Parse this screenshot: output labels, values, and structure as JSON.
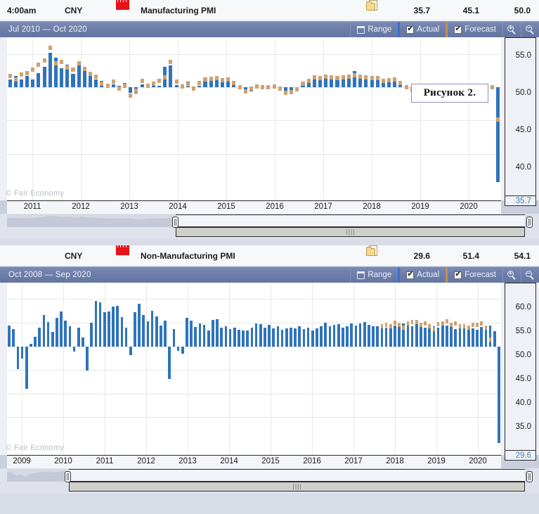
{
  "events": [
    {
      "time": "4:00am",
      "currency": "CNY",
      "flag_icon": "china-flag-icon",
      "detail_icon": "detail-folder-icon",
      "title": "Manufacturing PMI",
      "actual": "35.7",
      "forecast": "45.1",
      "previous": "50.0",
      "chart": {
        "range_label": "Jul 2010 — Oct 2020",
        "toolbar": {
          "range_label": "Range",
          "range_icon": "calendar-icon",
          "actual_label": "Actual",
          "actual_checked": true,
          "forecast_label": "Forecast",
          "forecast_checked": true,
          "zoom_in_icon": "magnifier-plus-icon",
          "zoom_out_icon": "magnifier-minus-icon"
        },
        "watermark": "© Fair Economy",
        "annotation": "Рисунок 2.",
        "current_value_label": "35.7"
      }
    },
    {
      "time": "",
      "currency": "CNY",
      "flag_icon": "china-flag-icon",
      "detail_icon": "detail-folder-icon",
      "title": "Non-Manufacturing PMI",
      "actual": "29.6",
      "forecast": "51.4",
      "previous": "54.1",
      "chart": {
        "range_label": "Oct 2008 — Sep 2020",
        "toolbar": {
          "range_label": "Range",
          "range_icon": "calendar-icon",
          "actual_label": "Actual",
          "actual_checked": true,
          "forecast_label": "Forecast",
          "forecast_checked": true,
          "zoom_in_icon": "magnifier-plus-icon",
          "zoom_out_icon": "magnifier-minus-icon"
        },
        "watermark": "© Fair Economy",
        "annotation": "",
        "current_value_label": "29.6"
      }
    }
  ],
  "chart_data": [
    {
      "type": "bar",
      "title": "Manufacturing PMI",
      "subtitle": "Jul 2010 — Oct 2020",
      "xlabel": "",
      "ylabel": "",
      "ylim": [
        33.0,
        57.5
      ],
      "baseline": 50.0,
      "grid": true,
      "legend": [
        "Actual",
        "Forecast"
      ],
      "legend_position": "toolbar",
      "yticks": [
        55.0,
        50.0,
        45.0,
        40.0
      ],
      "ytick_labels": [
        "55.0",
        "50.0",
        "45.0",
        "40.0"
      ],
      "current_value": 35.7,
      "xticks": [
        "2011",
        "2012",
        "2013",
        "2014",
        "2015",
        "2016",
        "2017",
        "2018",
        "2019",
        "2020"
      ],
      "series": [
        {
          "name": "Actual",
          "color": "#2f74bb",
          "values": [
            51.2,
            51.7,
            51.2,
            51.7,
            51.2,
            52.1,
            53.1,
            55.2,
            54.4,
            52.9,
            53.4,
            52.0,
            53.3,
            52.4,
            51.8,
            51.2,
            50.9,
            50.1,
            50.4,
            50.2,
            50.6,
            49.2,
            49.0,
            50.4,
            50.1,
            50.6,
            50.2,
            53.1,
            53.3,
            50.3,
            50.4,
            50.8,
            50.1,
            50.2,
            51.0,
            51.1,
            51.7,
            51.4,
            51.1,
            50.8,
            50.1,
            49.7,
            49.4,
            49.8,
            50.1,
            49.9,
            50.2,
            50.1,
            49.4,
            49.0,
            49.4,
            50.2,
            51.2,
            51.7,
            51.6,
            51.8,
            51.3,
            51.2,
            51.6,
            51.4,
            52.4,
            51.7,
            51.2,
            51.5,
            51.6,
            51.2,
            50.8,
            51.5,
            50.9,
            50.3,
            49.4,
            49.2,
            49.5,
            49.2,
            49.4,
            49.7,
            50.2,
            49.4,
            49.7,
            49.5,
            49.8,
            49.9,
            49.8,
            50.2,
            50.1,
            35.7
          ],
          "note": "Monthly China Manufacturing PMI, approximate read from plot"
        },
        {
          "name": "Forecast",
          "color": "#cda273",
          "values": [
            51.7,
            51.2,
            51.9,
            52.1,
            52.6,
            53.4,
            54.0,
            55.9,
            53.6,
            53.8,
            53.0,
            52.6,
            53.6,
            52.8,
            52.0,
            51.6,
            50.5,
            50.2,
            50.8,
            49.8,
            50.2,
            48.7,
            49.5,
            50.9,
            50.2,
            50.5,
            50.9,
            51.5,
            53.8,
            50.8,
            50.1,
            50.4,
            49.8,
            50.6,
            51.2,
            51.3,
            51.4,
            51.1,
            51.2,
            50.6,
            50.0,
            49.4,
            49.8,
            50.1,
            50.0,
            50.0,
            50.1,
            49.8,
            49.2,
            49.3,
            49.7,
            50.5,
            51.0,
            51.5,
            51.4,
            51.6,
            51.5,
            51.4,
            51.5,
            51.6,
            51.8,
            51.6,
            51.5,
            51.4,
            51.4,
            51.0,
            51.1,
            51.2,
            50.6,
            50.0,
            49.6,
            49.5,
            49.3,
            49.6,
            49.6,
            50.0,
            49.9,
            49.6,
            49.5,
            49.8,
            50.0,
            50.1,
            50.0,
            50.1,
            50.0,
            45.1
          ]
        }
      ]
    },
    {
      "type": "bar",
      "title": "Non-Manufacturing PMI",
      "subtitle": "Oct 2008 — Sep 2020",
      "xlabel": "",
      "ylabel": "",
      "ylim": [
        27.0,
        63.5
      ],
      "baseline": 50.0,
      "grid": true,
      "legend": [
        "Actual",
        "Forecast"
      ],
      "legend_position": "toolbar",
      "yticks": [
        60.0,
        55.0,
        50.0,
        45.0,
        40.0,
        35.0
      ],
      "ytick_labels": [
        "60.0",
        "55.0",
        "50.0",
        "45.0",
        "40.0",
        "35.0"
      ],
      "current_value": 29.6,
      "xticks": [
        "2009",
        "2010",
        "2011",
        "2012",
        "2013",
        "2014",
        "2015",
        "2016",
        "2017",
        "2018",
        "2019",
        "2020"
      ],
      "series": [
        {
          "name": "Actual",
          "color": "#2f74bb",
          "values": [
            54.4,
            53.6,
            45.2,
            47.4,
            41.0,
            50.5,
            52.0,
            54.0,
            56.6,
            55.1,
            53.0,
            56.0,
            57.4,
            55.5,
            54.2,
            48.9,
            53.9,
            51.9,
            44.9,
            55.0,
            59.6,
            59.4,
            57.2,
            57.4,
            58.4,
            58.6,
            56.2,
            53.9,
            48.1,
            57.3,
            59.0,
            56.7,
            55.3,
            57.6,
            56.4,
            54.4,
            55.5,
            43.1,
            53.7,
            49.1,
            48.5,
            56.0,
            55.4,
            54.1,
            54.9,
            54.5,
            53.3,
            55.6,
            55.8,
            54.0,
            54.2,
            53.6,
            53.9,
            53.5,
            53.4,
            53.3,
            53.9,
            54.8,
            54.7,
            53.9,
            54.6,
            53.8,
            54.2,
            53.5,
            53.8,
            54.0,
            53.8,
            54.3,
            53.7,
            54.0,
            53.4,
            53.8,
            54.3,
            55.0,
            54.3,
            54.5,
            54.7,
            54.0,
            54.3,
            54.9,
            54.4,
            54.8,
            55.1,
            54.6,
            54.2,
            54.2,
            54.3,
            54.0,
            53.9,
            54.4,
            54.8,
            54.8,
            55.0,
            54.3,
            54.8,
            54.4,
            53.9,
            54.5,
            54.2,
            53.9,
            54.7,
            54.4,
            54.2,
            53.7,
            54.2,
            54.4,
            53.6,
            53.8,
            53.5,
            54.1,
            54.2,
            54.4,
            53.2,
            29.6
          ]
        },
        {
          "name": "Forecast",
          "color": "#cda273",
          "values": [
            null,
            null,
            null,
            null,
            null,
            null,
            null,
            null,
            null,
            null,
            null,
            null,
            null,
            null,
            null,
            null,
            null,
            null,
            null,
            null,
            null,
            null,
            null,
            null,
            null,
            null,
            null,
            null,
            null,
            null,
            null,
            null,
            null,
            null,
            null,
            null,
            null,
            null,
            null,
            null,
            null,
            null,
            null,
            null,
            null,
            null,
            null,
            null,
            null,
            null,
            null,
            null,
            null,
            null,
            null,
            null,
            null,
            null,
            null,
            null,
            null,
            null,
            null,
            null,
            null,
            null,
            null,
            null,
            null,
            null,
            null,
            null,
            null,
            null,
            null,
            null,
            null,
            null,
            null,
            null,
            null,
            null,
            null,
            null,
            null,
            null,
            54.3,
            54.6,
            54.3,
            55.0,
            54.5,
            53.9,
            54.9,
            55.2,
            55.1,
            54.5,
            54.8,
            54.2,
            53.6,
            54.7,
            54.9,
            55.3,
            54.6,
            54.9,
            54.3,
            54.2,
            54.0,
            54.5,
            54.6,
            54.8,
            53.9,
            51.4
          ]
        }
      ]
    }
  ]
}
